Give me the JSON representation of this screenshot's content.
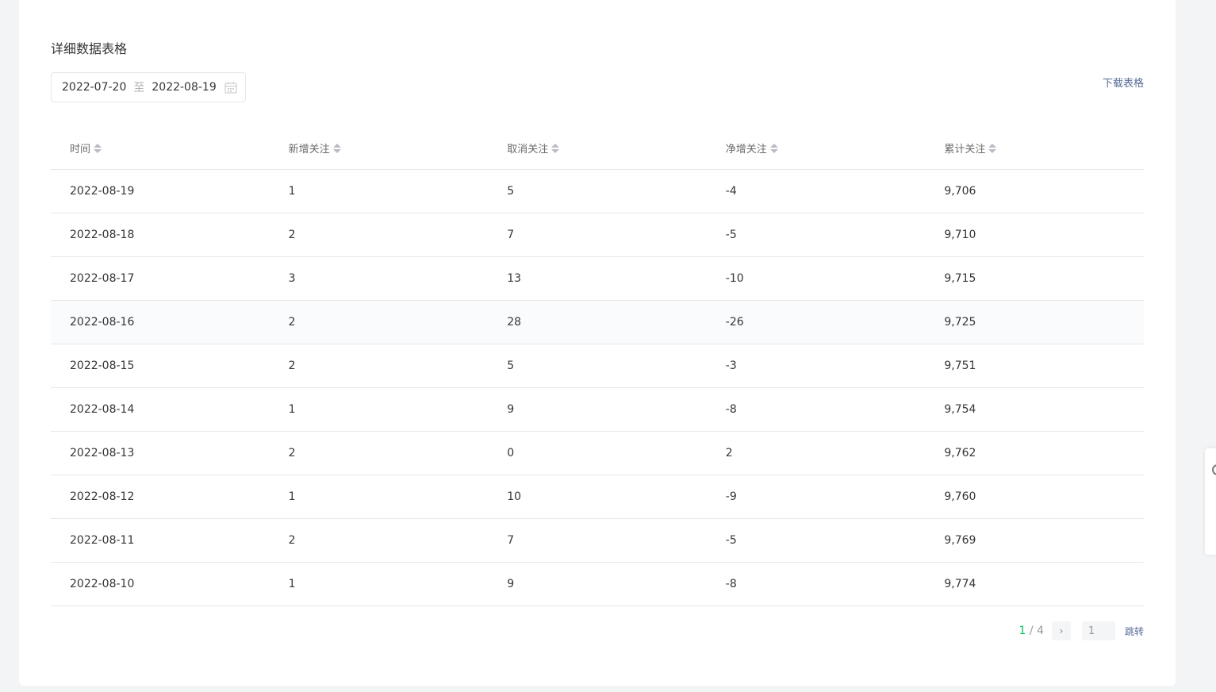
{
  "section": {
    "title": "详细数据表格"
  },
  "date_range": {
    "start": "2022-07-20",
    "separator": "至",
    "end": "2022-08-19"
  },
  "download_label": "下载表格",
  "table": {
    "headers": [
      "时间",
      "新增关注",
      "取消关注",
      "净增关注",
      "累计关注"
    ],
    "rows": [
      [
        "2022-08-19",
        "1",
        "5",
        "-4",
        "9,706"
      ],
      [
        "2022-08-18",
        "2",
        "7",
        "-5",
        "9,710"
      ],
      [
        "2022-08-17",
        "3",
        "13",
        "-10",
        "9,715"
      ],
      [
        "2022-08-16",
        "2",
        "28",
        "-26",
        "9,725"
      ],
      [
        "2022-08-15",
        "2",
        "5",
        "-3",
        "9,751"
      ],
      [
        "2022-08-14",
        "1",
        "9",
        "-8",
        "9,754"
      ],
      [
        "2022-08-13",
        "2",
        "0",
        "2",
        "9,762"
      ],
      [
        "2022-08-12",
        "1",
        "10",
        "-9",
        "9,760"
      ],
      [
        "2022-08-11",
        "2",
        "7",
        "-5",
        "9,769"
      ],
      [
        "2022-08-10",
        "1",
        "9",
        "-8",
        "9,774"
      ]
    ]
  },
  "pagination": {
    "current": "1",
    "separator": " / ",
    "total": "4",
    "next_glyph": "›",
    "jump_value": "1",
    "jump_label": "跳转"
  },
  "colors": {
    "accent": "#07c160",
    "link": "#576b95"
  },
  "icons": {
    "calendar": "calendar-icon",
    "sort": "sort-icon",
    "next": "chevron-right-icon"
  }
}
